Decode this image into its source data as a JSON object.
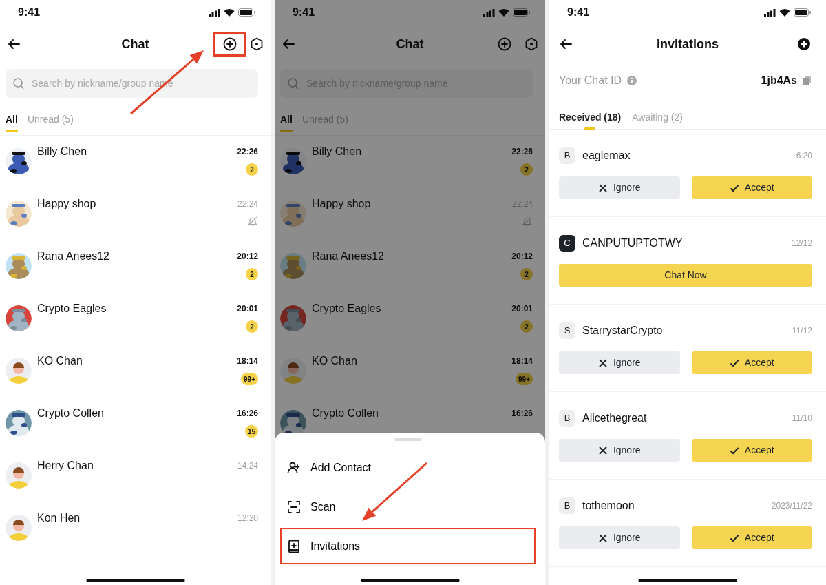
{
  "chat_screen": {
    "status_bar": {
      "time": "9:41"
    },
    "title": "Chat",
    "add_button": {
      "highlighted": true
    },
    "search": {
      "placeholder": "Search by nickname/group name"
    },
    "tabs": [
      {
        "label": "All",
        "selected": true
      },
      {
        "label": "Unread (5)",
        "selected": false
      }
    ],
    "chats": [
      {
        "name": "Billy Chen",
        "time": "22:26",
        "unread": true,
        "badge": "2",
        "muted": false,
        "photo": true
      },
      {
        "name": "Happy shop",
        "time": "22:24",
        "unread": false,
        "muted": true,
        "photo": true
      },
      {
        "name": "Rana Anees12",
        "time": "20:12",
        "unread": true,
        "badge": "2",
        "muted": false,
        "photo": true
      },
      {
        "name": "Crypto Eagles",
        "time": "20:01",
        "unread": true,
        "badge": "2",
        "muted": false,
        "photo": true
      },
      {
        "name": "KO Chan",
        "time": "18:14",
        "unread": true,
        "badge": "99+",
        "muted": false,
        "photo": false
      },
      {
        "name": "Crypto Collen",
        "time": "16:26",
        "unread": true,
        "badge": "15",
        "muted": false,
        "photo": true
      },
      {
        "name": "Herry Chan",
        "time": "14:24",
        "unread": false,
        "muted": false,
        "photo": false
      },
      {
        "name": "Kon Hen",
        "time": "12:20",
        "unread": false,
        "muted": false,
        "photo": false
      }
    ]
  },
  "chat_menu_screen": {
    "status_bar": {
      "time": "9:41"
    },
    "title": "Chat",
    "add_button": {
      "highlighted": false
    },
    "search": {
      "placeholder": "Search by nickname/group name"
    },
    "tabs": [
      {
        "label": "All",
        "selected": true
      },
      {
        "label": "Unread (5)",
        "selected": false
      }
    ],
    "chats": [
      {
        "name": "Billy Chen",
        "time": "22:26",
        "unread": true,
        "badge": "2",
        "muted": false,
        "photo": true
      },
      {
        "name": "Happy shop",
        "time": "22:24",
        "unread": false,
        "muted": true,
        "photo": true
      },
      {
        "name": "Rana Anees12",
        "time": "20:12",
        "unread": true,
        "badge": "2",
        "muted": false,
        "photo": true
      },
      {
        "name": "Crypto Eagles",
        "time": "20:01",
        "unread": true,
        "badge": "2",
        "muted": false,
        "photo": true
      },
      {
        "name": "KO Chan",
        "time": "18:14",
        "unread": true,
        "badge": "99+",
        "muted": false,
        "photo": false
      },
      {
        "name": "Crypto Collen",
        "time": "16:26",
        "unread": true,
        "muted": false,
        "photo": true
      }
    ],
    "menu": [
      {
        "label": "Add Contact",
        "kind": "add-contact",
        "highlighted": false
      },
      {
        "label": "Scan",
        "kind": "scan",
        "highlighted": false
      },
      {
        "label": "Invitations",
        "kind": "invitations",
        "highlighted": true
      }
    ]
  },
  "invitations_screen": {
    "status_bar": {
      "time": "9:41"
    },
    "title": "Invitations",
    "chat_id_label": "Your Chat ID",
    "chat_id": "1jb4As",
    "tabs": [
      {
        "label": "Received (18)",
        "selected": true
      },
      {
        "label": "Awaiting (2)",
        "selected": false
      }
    ],
    "invitations": [
      {
        "initial": "B",
        "name": "eaglemax",
        "date": "6:20",
        "dark": false,
        "actions": [
          {
            "kind": "ignore",
            "label": "Ignore"
          },
          {
            "kind": "accept",
            "label": "Accept"
          }
        ]
      },
      {
        "initial": "C",
        "name": "CANPUTUPTOTWY",
        "date": "12/12",
        "dark": true,
        "actions": [
          {
            "kind": "chat",
            "label": "Chat Now"
          }
        ]
      },
      {
        "initial": "S",
        "name": "StarrystarCrypto",
        "date": "11/12",
        "dark": false,
        "actions": [
          {
            "kind": "ignore",
            "label": "Ignore"
          },
          {
            "kind": "accept",
            "label": "Accept"
          }
        ]
      },
      {
        "initial": "B",
        "name": "Alicethegreat",
        "date": "11/10",
        "dark": false,
        "actions": [
          {
            "kind": "ignore",
            "label": "Ignore"
          },
          {
            "kind": "accept",
            "label": "Accept"
          }
        ]
      },
      {
        "initial": "B",
        "name": "tothemoon",
        "date": "2023/11/22",
        "dark": false,
        "actions": [
          {
            "kind": "ignore",
            "label": "Ignore"
          },
          {
            "kind": "accept",
            "label": "Accept"
          }
        ]
      }
    ]
  }
}
